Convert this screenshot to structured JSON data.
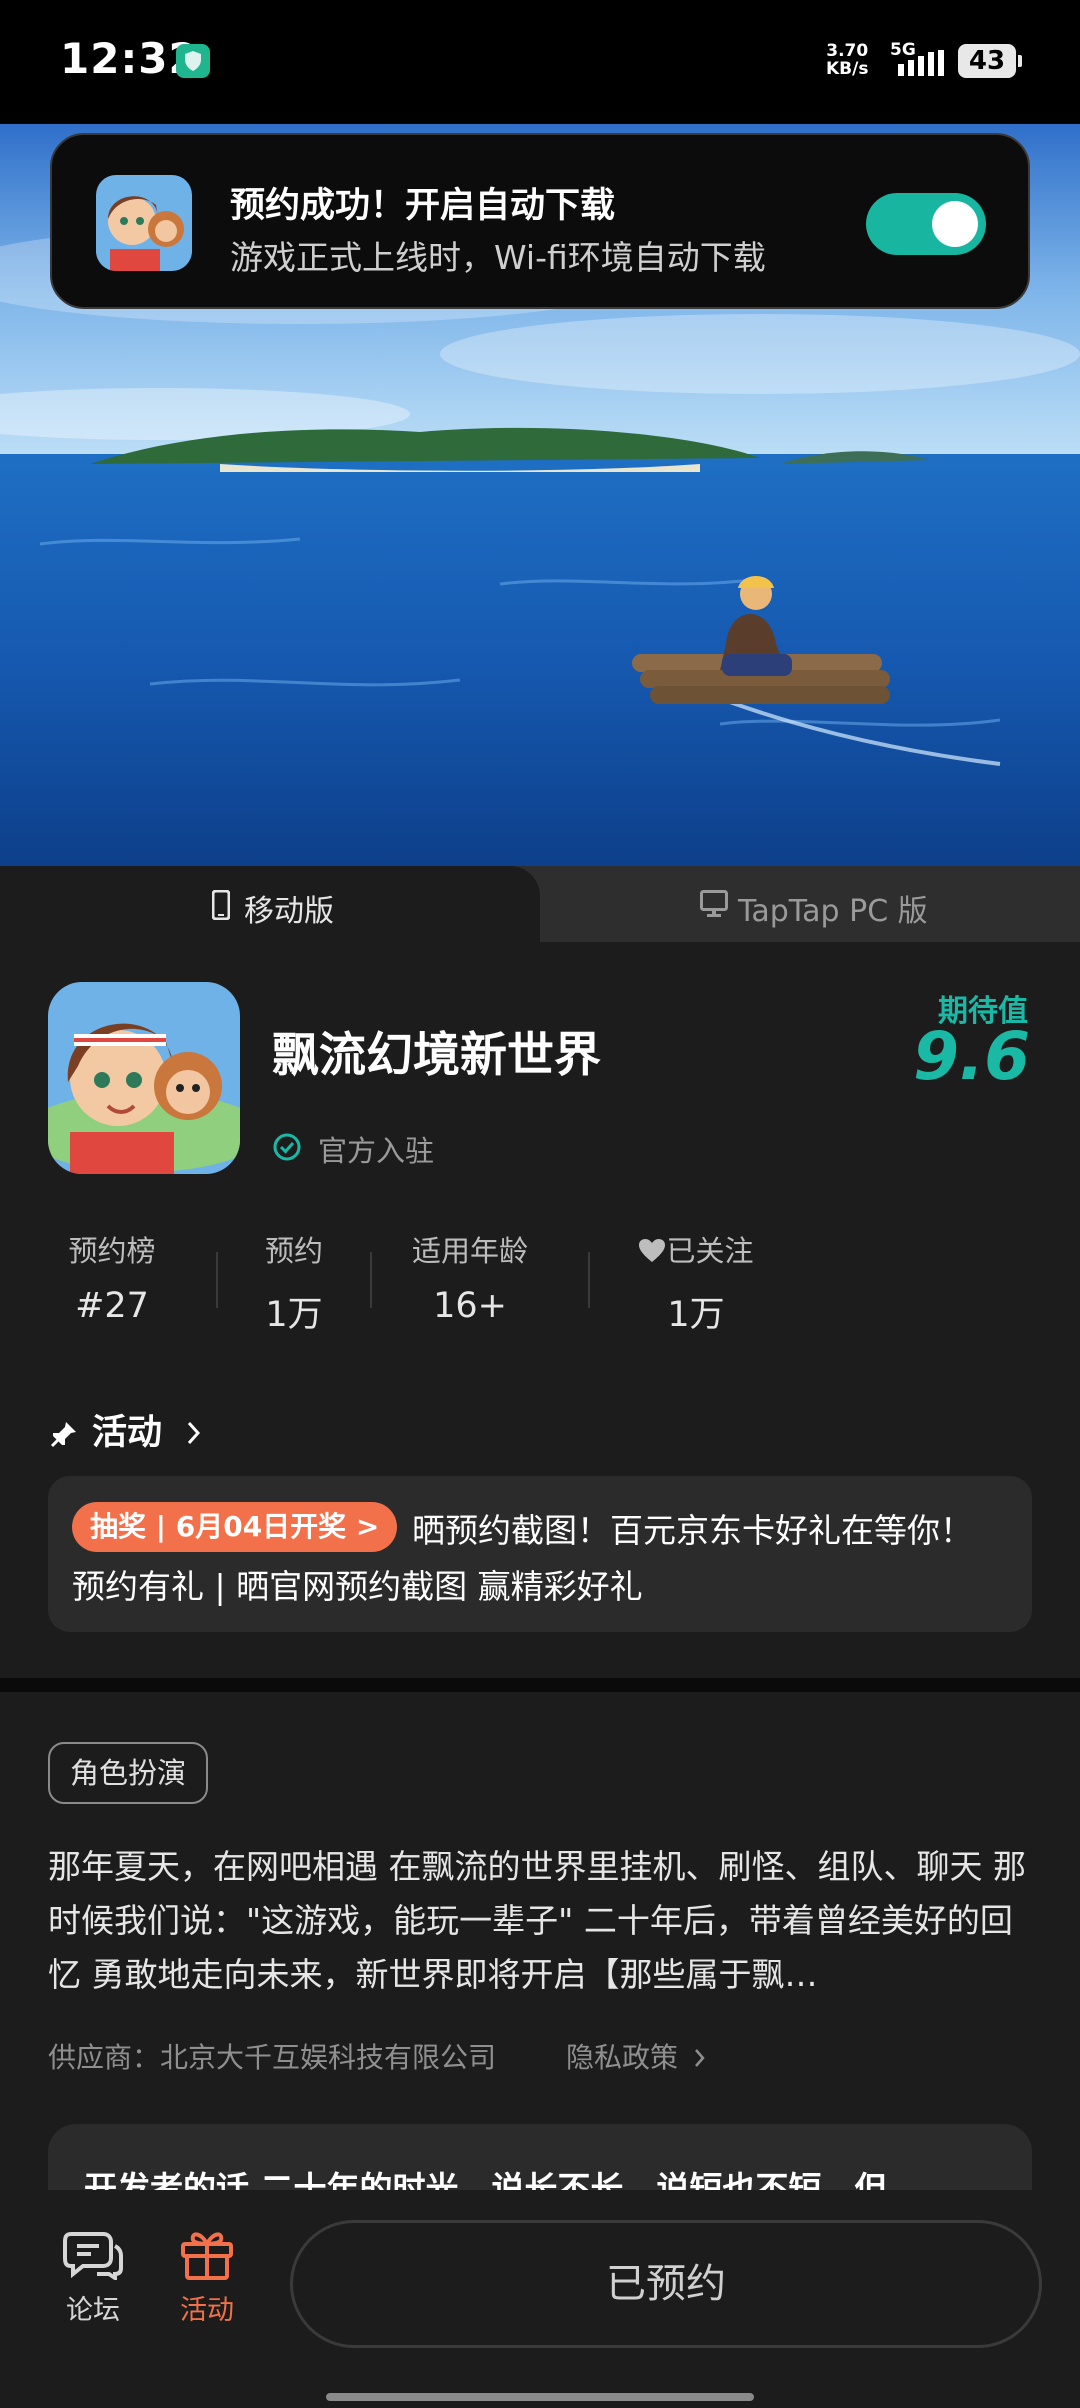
{
  "status_bar": {
    "time": "12:32",
    "net_speed": "3.70",
    "net_unit": "KB/s",
    "network": "5G",
    "battery": "43"
  },
  "notification": {
    "title": "预约成功！开启自动下载",
    "subtitle": "游戏正式上线时，Wi-fi环境自动下载",
    "toggle_on": true,
    "accent": "#18b5a0"
  },
  "platform_tabs": {
    "mobile": "移动版",
    "pc": "TapTap PC 版"
  },
  "game": {
    "title": "飘流幻境新世界",
    "official": "官方入驻",
    "expect_label": "期待值",
    "expect_score": "9.6",
    "stats": [
      {
        "label": "预约榜",
        "value": "#27"
      },
      {
        "label": "预约",
        "value": "1万"
      },
      {
        "label": "适用年龄",
        "value": "16+"
      },
      {
        "label": "已关注",
        "value": "1万"
      }
    ]
  },
  "activity": {
    "heading": "活动",
    "badge": "抽奖 | 6月04日开奖 >",
    "line1": "晒预约截图！百元京东卡好礼在等你！",
    "line2": "预约有礼 | 晒官网预约截图 赢精彩好礼"
  },
  "description": {
    "tag": "角色扮演",
    "text": "那年夏天，在网吧相遇 在飘流的世界里挂机、刷怪、组队、聊天 那时候我们说：\"这游戏，能玩一辈子\" 二十年后，带着曾经美好的回忆 勇敢地走向未来，新世界即将开启【那些属于飘…",
    "supplier": "供应商：北京大千互娱科技有限公司",
    "privacy": "隐私政策"
  },
  "developer_note": "开发者的话 二十年的时光，说长不长，说短也不短，但",
  "bottom_nav": {
    "forum": "论坛",
    "activity": "活动",
    "reserve_button": "已预约"
  }
}
